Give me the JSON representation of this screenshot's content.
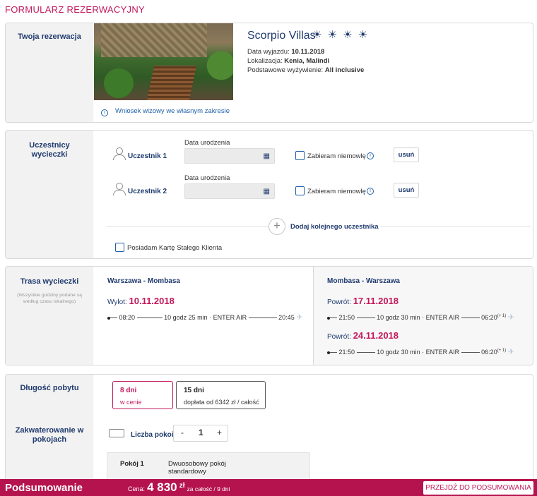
{
  "page": {
    "title": "FORMULARZ REZERWACYJNY"
  },
  "reservation": {
    "section_label": "Twoja rezerwacja",
    "hotel_name": "Scorpio Villas",
    "stars": "☀ ☀ ☀ ☀",
    "departure_label": "Data wyjazdu:",
    "departure_value": "10.11.2018",
    "location_label": "Lokalizacja:",
    "location_value": "Kenia, Malindi",
    "board_label": "Podstawowe wyżywienie:",
    "board_value": "All inclusive",
    "visa_link": "Wniosek wizowy we własnym zakresie",
    "info_icon": "i"
  },
  "participants": {
    "section_label": "Uczestnicy wycieczki",
    "dob_label": "Data urodzenia",
    "calendar_icon": "▦",
    "infant_label": "Zabieram niemowlę",
    "remove_label": "usuń",
    "list": [
      {
        "name": "Uczestnik 1"
      },
      {
        "name": "Uczestnik 2"
      }
    ],
    "add_label": "Dodaj kolejnego uczestnika",
    "add_icon": "+",
    "loyalty_card_label": "Posiadam Kartę Stałego Klienta"
  },
  "route": {
    "section_label": "Trasa wycieczki",
    "section_note": "(Wszystkie godziny podane są według czasu lokalnego)",
    "outbound": {
      "title": "Warszawa - Mombasa",
      "date_label": "Wylot:",
      "date": "10.11.2018",
      "dep_time": "08:20",
      "duration": "10 godz 25 min",
      "carrier": "ENTER AIR",
      "arr_time": "20:45"
    },
    "return": {
      "title": "Mombasa - Warszawa",
      "options": [
        {
          "date_label": "Powrót:",
          "date": "17.11.2018",
          "dep_time": "21:50",
          "duration": "10 godz 30 min",
          "carrier": "ENTER AIR",
          "arr_time": "06:20",
          "day_shift": "(+ 1)"
        },
        {
          "date_label": "Powrót:",
          "date": "24.11.2018",
          "dep_time": "21:50",
          "duration": "10 godz 30 min",
          "carrier": "ENTER AIR",
          "arr_time": "06:20",
          "day_shift": "(+ 1)"
        }
      ]
    },
    "plane_icon": "✈"
  },
  "stay": {
    "section_label": "Długość pobytu",
    "options": [
      {
        "days": "8 dni",
        "note": "w cenie",
        "selected": true
      },
      {
        "days": "15 dni",
        "note": "dopłata od 6342 zł / całość",
        "selected": false
      }
    ]
  },
  "rooms": {
    "section_label": "Zakwaterowanie w pokojach",
    "count_label": "Liczba pokoi",
    "minus": "-",
    "count": "1",
    "plus": "+",
    "room_label": "Pokój 1",
    "room_desc": "Dwuosobowy pokój standardowy"
  },
  "footer": {
    "title": "Podsumowanie",
    "price_label": "Cena:",
    "price_value": "4 830",
    "currency": "zł",
    "price_suffix": "za całość / 9 dni",
    "cta": "PRZEJDŹ DO PODSUMOWANIA"
  },
  "colors": {
    "accent": "#c2185b",
    "navy": "#1f3a6e",
    "footer_bg": "#b5134d"
  }
}
